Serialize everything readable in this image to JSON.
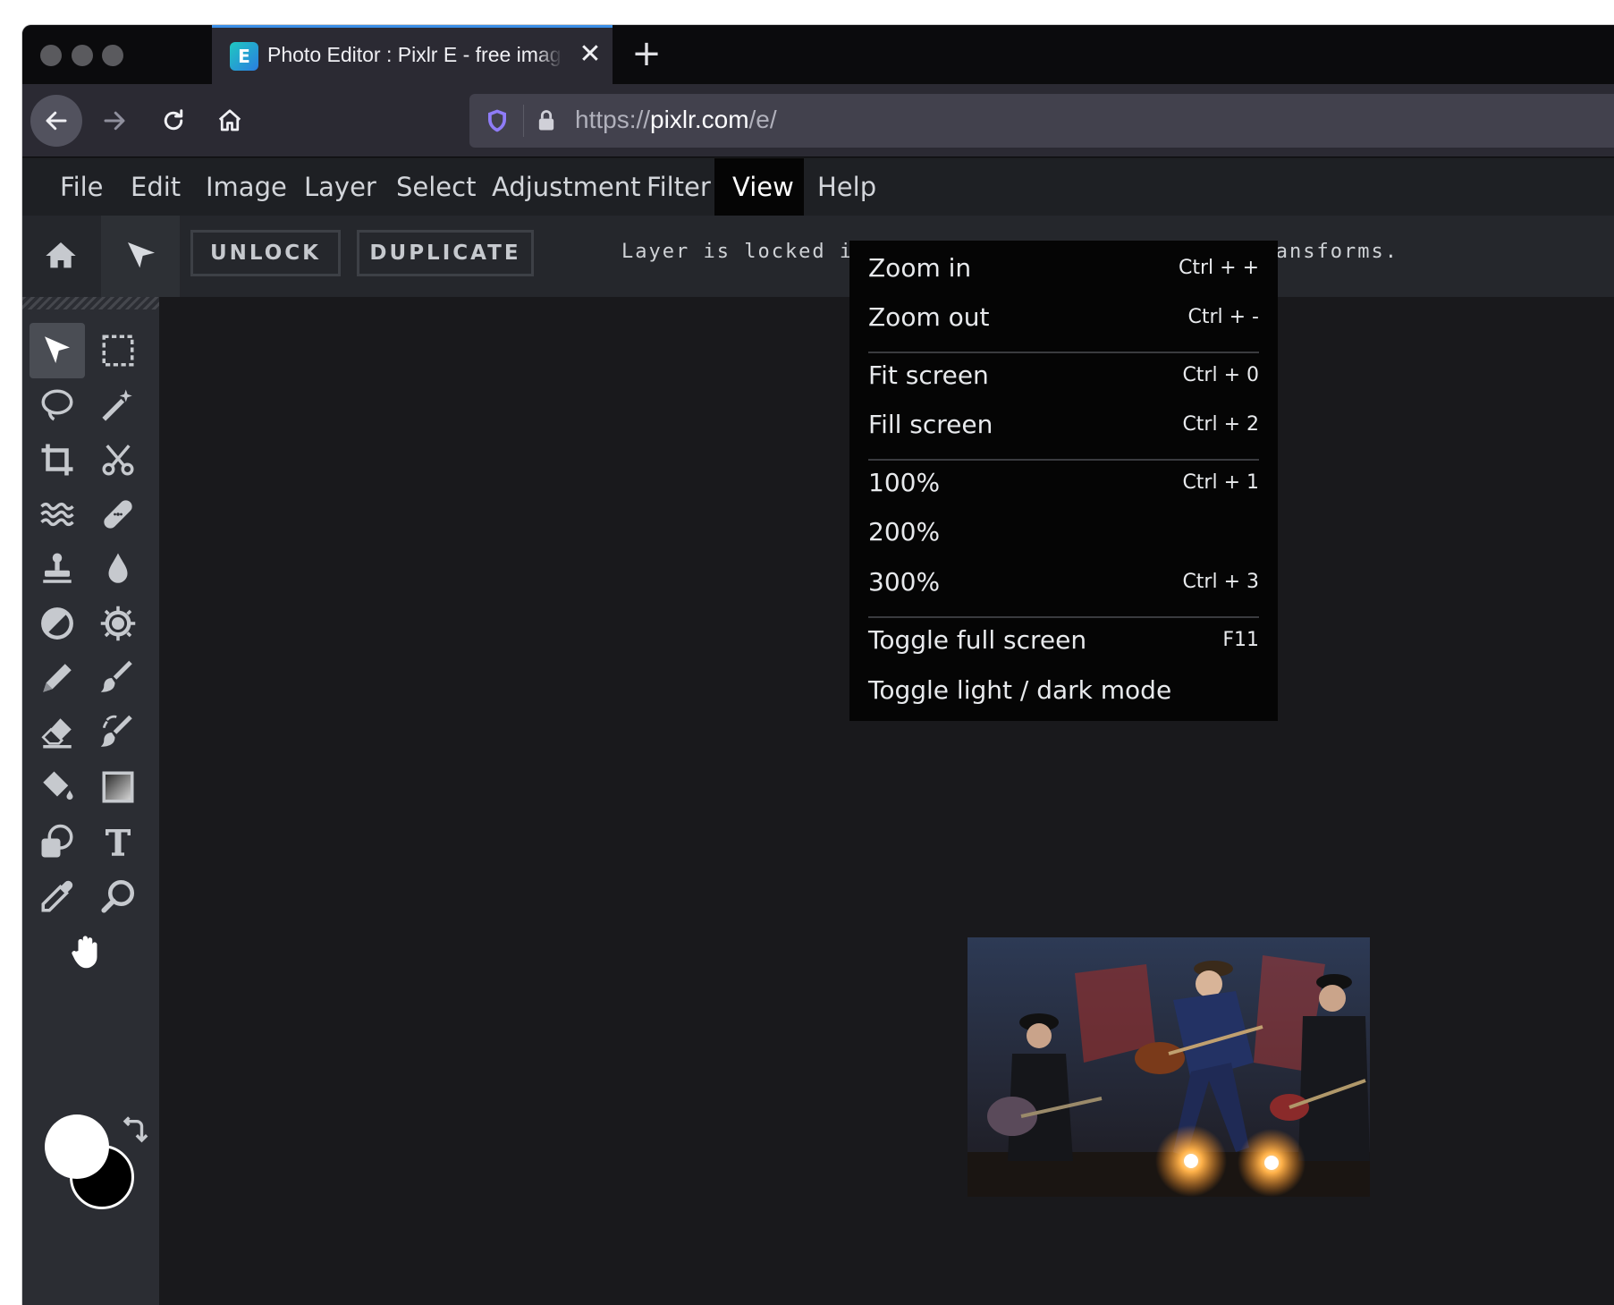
{
  "browser": {
    "tab_favicon": "E",
    "tab_title": "Photo Editor : Pixlr E - free image editor",
    "tab_close": "✕",
    "new_tab": "+",
    "url_scheme": "https://",
    "url_host": "pixlr.com",
    "url_path": "/e/"
  },
  "menu": {
    "file": "File",
    "edit": "Edit",
    "image": "Image",
    "layer": "Layer",
    "select": "Select",
    "adjustment": "Adjustment",
    "filter": "Filter",
    "view": "View",
    "help": "Help"
  },
  "options": {
    "unlock": "UNLOCK",
    "duplicate": "DUPLICATE",
    "message": "Layer is locked in position, unlock to enable transforms."
  },
  "view_menu": {
    "items": [
      {
        "label": "Zoom in",
        "shortcut": "Ctrl + +"
      },
      {
        "label": "Zoom out",
        "shortcut": "Ctrl + -"
      },
      {
        "label": "Fit screen",
        "shortcut": "Ctrl + 0"
      },
      {
        "label": "Fill screen",
        "shortcut": "Ctrl + 2"
      },
      {
        "label": "100%",
        "shortcut": "Ctrl + 1"
      },
      {
        "label": "200%",
        "shortcut": ""
      },
      {
        "label": "300%",
        "shortcut": "Ctrl + 3"
      },
      {
        "label": "Toggle full screen",
        "shortcut": "F11"
      },
      {
        "label": "Toggle light / dark mode",
        "shortcut": ""
      }
    ]
  },
  "colors": {
    "foreground": "#ffffff",
    "background": "#000000",
    "accent": "#3a8ee6"
  }
}
